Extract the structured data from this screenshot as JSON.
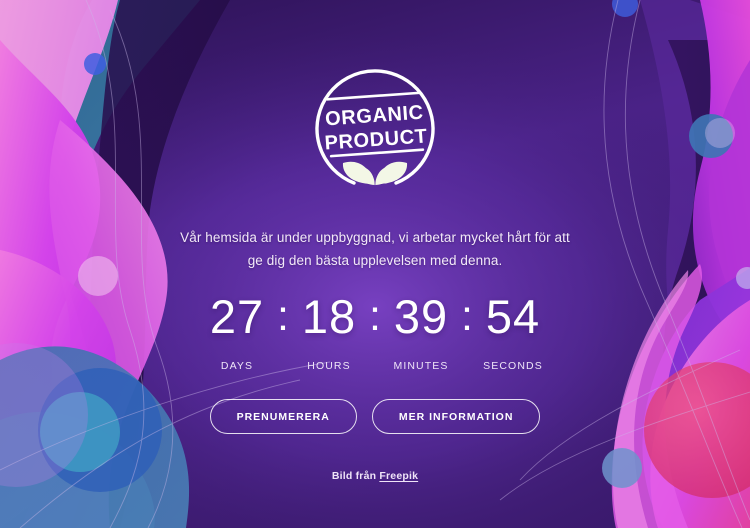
{
  "page": {
    "background_color": "#3c1d70",
    "accent_magenta": "#d63ef0",
    "accent_blue": "#3f7fbf",
    "text_color": "#f2e9f8"
  },
  "logo": {
    "icon_name": "organic-product-badge",
    "line1": "ORGANIC",
    "line2": "PRODUCT",
    "leaf_icon_name": "two-leaves-icon"
  },
  "intro": {
    "line1": "Vår hemsida är under uppbyggnad, vi arbetar mycket hårt för att",
    "line2": "ge dig den bästa upplevelsen med denna.",
    "full": "Vår hemsida är under uppbyggnad, vi arbetar mycket hårt för att ge dig den bästa upplevelsen med denna."
  },
  "countdown": {
    "separator": ":",
    "units": [
      {
        "value": "27",
        "label": "DAYS"
      },
      {
        "value": "18",
        "label": "HOURS"
      },
      {
        "value": "39",
        "label": "MINUTES"
      },
      {
        "value": "54",
        "label": "SECONDS"
      }
    ]
  },
  "buttons": {
    "primary": "PRENUMERERA",
    "secondary": "MER INFORMATION"
  },
  "credit": {
    "prefix": "Bild från ",
    "link": "Freepik"
  }
}
